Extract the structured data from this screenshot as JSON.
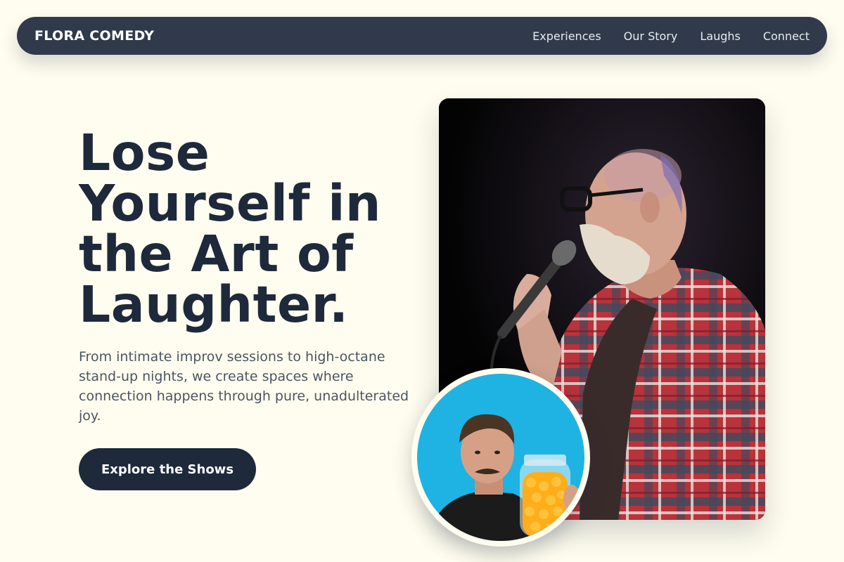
{
  "nav": {
    "brand": "FLORA COMEDY",
    "links": [
      "Experiences",
      "Our Story",
      "Laughs",
      "Connect"
    ]
  },
  "hero": {
    "headline": "Lose Yourself in the Art of Laughter.",
    "subtext": "From intimate improv sessions to high-octane stand-up nights, we create spaces where connection happens through pure, unadulterated joy.",
    "cta": "Explore the Shows"
  },
  "colors": {
    "background": "#fefdef",
    "nav": "#303a4b",
    "ink": "#1e293b",
    "muted": "#4b5563"
  },
  "images": {
    "main": "comedian-on-stage-with-microphone-photo",
    "inset": "comedian-with-candy-jar-photo"
  }
}
